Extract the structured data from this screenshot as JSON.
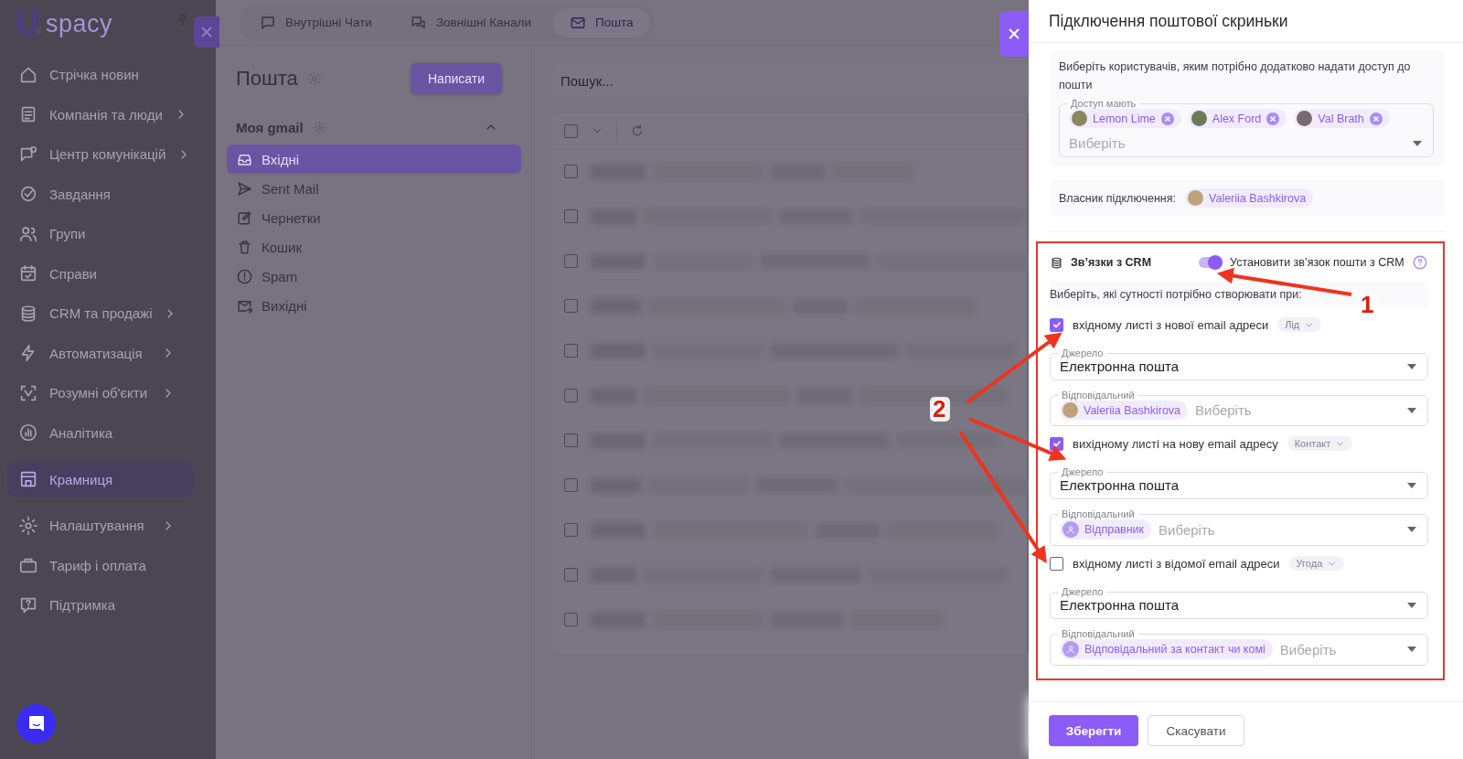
{
  "app_sidebar": {
    "logo_text": "spacy",
    "items": [
      {
        "label": "Стрічка новин",
        "expandable": false,
        "selected": false
      },
      {
        "label": "Компанія та люди",
        "expandable": true,
        "selected": false
      },
      {
        "label": "Центр комунікацій",
        "expandable": true,
        "selected": false
      },
      {
        "label": "Завдання",
        "expandable": false,
        "selected": false
      },
      {
        "label": "Групи",
        "expandable": false,
        "selected": false
      },
      {
        "label": "Справи",
        "expandable": false,
        "selected": false
      },
      {
        "label": "CRM та продажі",
        "expandable": true,
        "selected": false
      },
      {
        "label": "Автоматизація",
        "expandable": true,
        "selected": false
      },
      {
        "label": "Розумні об'єкти",
        "expandable": true,
        "selected": false
      },
      {
        "label": "Аналітика",
        "expandable": false,
        "selected": false
      },
      {
        "label": "Крамниця",
        "expandable": false,
        "selected": true
      },
      {
        "label": "Налаштування",
        "expandable": true,
        "selected": false
      },
      {
        "label": "Тариф і оплата",
        "expandable": false,
        "selected": false
      },
      {
        "label": "Підтримка",
        "expandable": false,
        "selected": false
      }
    ]
  },
  "top_tabs": [
    {
      "label": "Внутрішні Чати",
      "selected": false
    },
    {
      "label": "Зовнішні Канали",
      "selected": false
    },
    {
      "label": "Пошта",
      "selected": true
    }
  ],
  "mail_panel": {
    "title": "Пошта",
    "compose_button": "Написати",
    "account": {
      "name": "Моя gmail",
      "expanded": true
    },
    "folders": [
      {
        "label": "Вхідні",
        "selected": true
      },
      {
        "label": "Sent Mail",
        "selected": false
      },
      {
        "label": "Чернетки",
        "selected": false
      },
      {
        "label": "Кошик",
        "selected": false
      },
      {
        "label": "Spam",
        "selected": false
      },
      {
        "label": "Вихідні",
        "selected": false
      }
    ]
  },
  "search": {
    "placeholder": "Пошук..."
  },
  "message_list": {
    "select_all_checked": false,
    "rows": [
      {
        "checked": false
      },
      {
        "checked": false
      },
      {
        "checked": false
      },
      {
        "checked": false
      },
      {
        "checked": false
      },
      {
        "checked": false
      },
      {
        "checked": false
      },
      {
        "checked": false
      },
      {
        "checked": false
      },
      {
        "checked": false
      },
      {
        "checked": false
      }
    ]
  },
  "drawer": {
    "title": "Підключення поштової скриньки",
    "access": {
      "hint": "Виберіть користувачів, яким потрібно додатково надати доступ до пошти",
      "field_label": "Доступ мають",
      "chips": [
        {
          "name": "Lemon Lime"
        },
        {
          "name": "Alex Ford"
        },
        {
          "name": "Val Brath"
        }
      ],
      "placeholder": "Виберіть"
    },
    "owner": {
      "label": "Власник підключення:",
      "name": "Valeriia Bashkirova"
    },
    "crm": {
      "title": "Зв’язки з CRM",
      "toggle_on": true,
      "toggle_label": "Установити зв’язок пошти з CRM",
      "hint": "Виберіть, які сутності потрібно створювати при:",
      "rules": [
        {
          "checked": true,
          "label": "вхідному листі з нової email адреси",
          "entity": "Лід",
          "source_label": "Джерело",
          "source": "Електронна пошта",
          "responsible_label": "Відповідальний",
          "responsible": {
            "kind": "person",
            "name": "Valeriia Bashkirova"
          },
          "placeholder": "Виберіть"
        },
        {
          "checked": true,
          "label": "вихідному листі на нову email адресу",
          "entity": "Контакт",
          "source_label": "Джерело",
          "source": "Електронна пошта",
          "responsible_label": "Відповідальний",
          "responsible": {
            "kind": "role",
            "name": "Відправник"
          },
          "placeholder": "Виберіть"
        },
        {
          "checked": false,
          "label": "вхідному листі з відомої email адреси",
          "entity": "Угода",
          "source_label": "Джерело",
          "source": "Електронна пошта",
          "responsible_label": "Відповідальний",
          "responsible": {
            "kind": "role",
            "name": "Відповідальний за контакт чи комі"
          },
          "placeholder": "Виберіть"
        }
      ]
    },
    "save_button": "Зберегти",
    "cancel_button": "Скасувати"
  },
  "annotations": {
    "callouts": [
      {
        "label": "1"
      },
      {
        "label": "2"
      }
    ]
  }
}
